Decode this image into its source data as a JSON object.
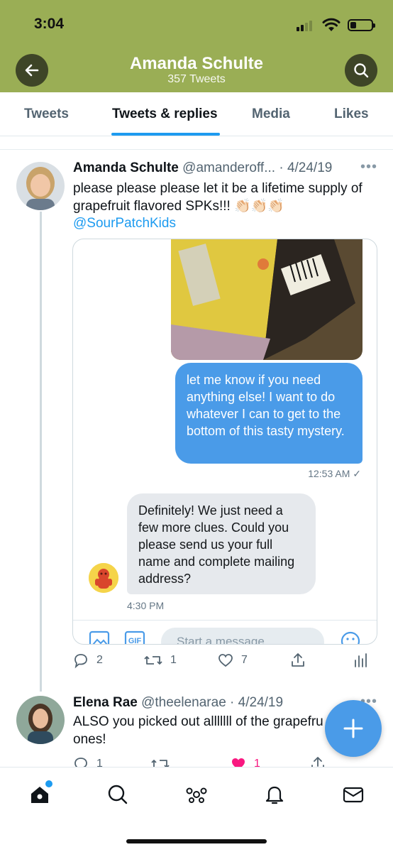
{
  "status_bar": {
    "time": "3:04"
  },
  "header": {
    "name": "Amanda Schulte",
    "tweet_count": "357 Tweets",
    "bg_color": "#9aae55"
  },
  "tabs": [
    {
      "label": "Tweets"
    },
    {
      "label": "Tweets & replies"
    },
    {
      "label": "Media"
    },
    {
      "label": "Likes"
    }
  ],
  "tweet1": {
    "display_name": "Amanda Schulte",
    "handle": "@amanderoff...",
    "date": "· 4/24/19",
    "text": "please please please let it be a lifetime supply of grapefruit flavored SPKs!!! 👏🏻👏🏻👏🏻",
    "mention": "@SourPatchKids",
    "dm": {
      "outgoing_text": "let me know if you need anything else! I want to do whatever I can to get to the bottom of this tasty mystery.",
      "outgoing_time": "12:53 AM ✓",
      "incoming_text": "Definitely! We just need a few more clues. Could you please send us your full name and complete mailing address?",
      "incoming_time": "4:30 PM",
      "composer_placeholder": "Start a message"
    },
    "actions": {
      "replies": "2",
      "retweets": "1",
      "likes": "7"
    }
  },
  "tweet2": {
    "display_name": "Elena Rae",
    "handle": "@theelenarae",
    "date": "· 4/24/19",
    "text_line1": "ALSO you picked out alllllll of the grapefru",
    "text_line2": "ones!",
    "actions": {
      "replies": "1",
      "likes": "1"
    }
  },
  "colors": {
    "accent": "#1d9bf0",
    "like": "#f91880"
  }
}
